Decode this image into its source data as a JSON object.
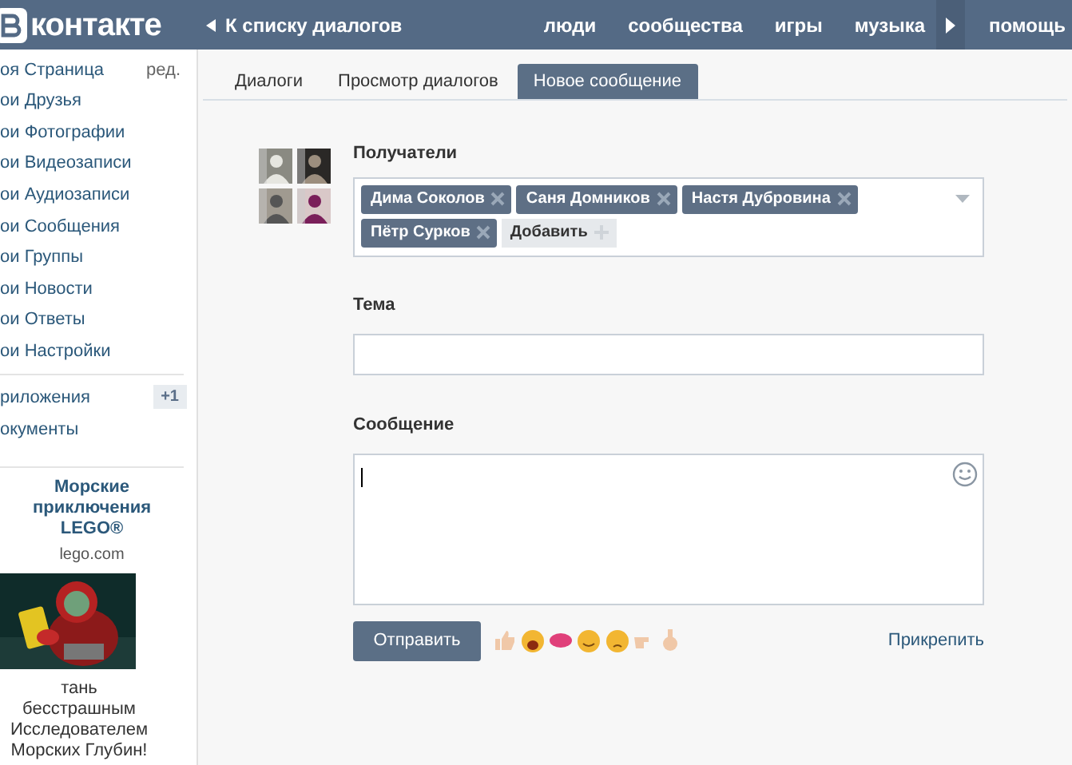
{
  "header": {
    "logo": "контакте",
    "back_link": "К списку диалогов",
    "nav": [
      "люди",
      "сообщества",
      "игры",
      "музыка",
      "помощь"
    ]
  },
  "sidebar": {
    "items": [
      {
        "label": "оя Страница",
        "edit": "ред."
      },
      {
        "label": "ои Друзья"
      },
      {
        "label": "ои Фотографии"
      },
      {
        "label": "ои Видеозаписи"
      },
      {
        "label": "ои Аудиозаписи"
      },
      {
        "label": "ои Сообщения"
      },
      {
        "label": "ои Группы"
      },
      {
        "label": "ои Новости"
      },
      {
        "label": "ои Ответы"
      },
      {
        "label": "ои Настройки"
      }
    ],
    "extra_items": [
      {
        "label": "риложения",
        "badge": "+1"
      },
      {
        "label": "окументы"
      }
    ],
    "ad": {
      "title": "Морские приключения LEGO®",
      "domain": "lego.com",
      "text": "тань бесстрашным Исследователем Морских Глубин!"
    }
  },
  "tabs": [
    {
      "label": "Диалоги",
      "selected": false
    },
    {
      "label": "Просмотр диалогов",
      "selected": false
    },
    {
      "label": "Новое сообщение",
      "selected": true
    }
  ],
  "form": {
    "recipients_label": "Получатели",
    "recipients": [
      "Дима Соколов",
      "Саня Домников",
      "Настя Дубровина",
      "Пётр Сурков"
    ],
    "add_button": "Добавить",
    "subject_label": "Тема",
    "message_label": "Сообщение",
    "send_button": "Отправить",
    "attach_link": "Прикрепить"
  }
}
